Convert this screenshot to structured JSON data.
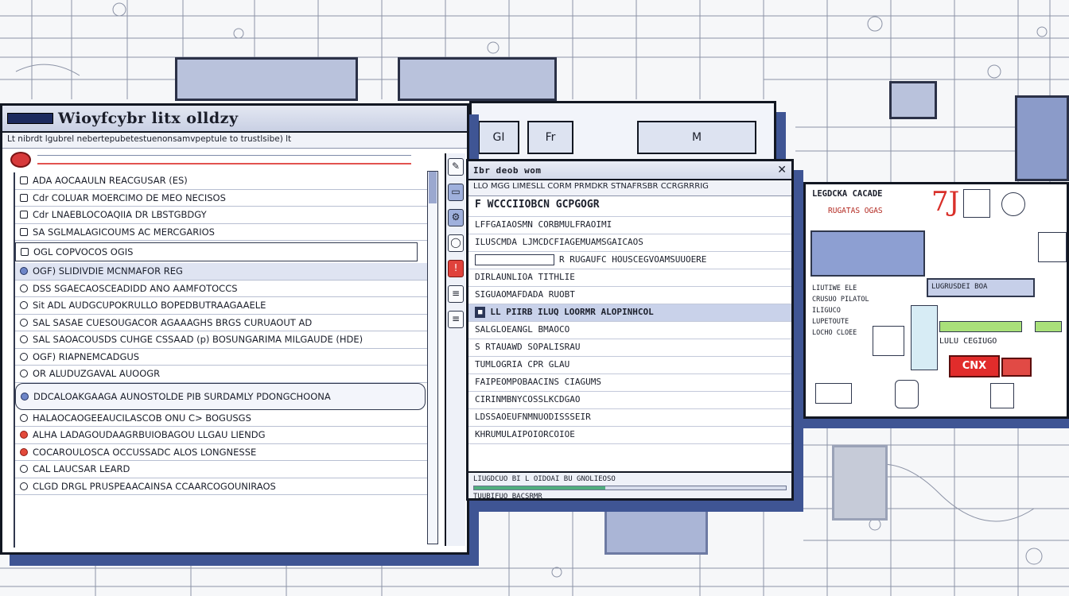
{
  "main_window": {
    "title": "Wioyfcybr litx olldzy",
    "menu": "Lt nibrdt lgubrel nebertepubetestuenonsamvpeptule to trustlsibe) lt",
    "rows": [
      "ADA AOCAAULN REACGUSAR (ES)",
      "Cdr COLUAR MOERCIMO DE MEO NECISOS",
      "Cdr LNAEBLOCOAQIIA DR LBSTGBDGY",
      "SA SGLMALAGICOUMS AC MERCGARIOS",
      "OGL COPVOCOS OGIS",
      "OGF) SLIDIVDIE MCNMAFOR REG",
      "DSS SGAECAOSCEADIDD ANO AAMFOTOCCS",
      "Sit ADL AUDGCUPOKRULLO BOPEDBUTRAAGAAELE",
      "SAL SASAE CUESOUGACOR AGAAAGHS BRGS CURUAOUT AD",
      "SAL SAOACOUSDS CUHGE CSSAAD (p) BOSUNGARIMA MILGAUDE (HDE)",
      "OGF) RIAPNEMCADGUS",
      "OR ALUDUZGAVAL AUOOGR",
      "DDCALOAKGAAGA AUNOSTOLDE PIB SURDAMLY PDONGCHOONA",
      "HALAOCAOGEEAUCILASCOB ONU C> BOGUSGS",
      "ALHA LADAGOUDAAGRBUIOBAGOU LLGAU LIENDG",
      "COCAROULOSCA OCCUSSADC ALOS LONGNESSE",
      "CAL LAUCSAR LEARD",
      "CLGD DRGL PRUSPEAACAINSA CCAARCOGOUNIRAOS"
    ]
  },
  "back_window": {
    "thumbs": [
      "GI",
      "Fr",
      "M"
    ]
  },
  "detail_window": {
    "title": "Ibr deob wom",
    "close_glyph": "✕",
    "menu": "LLO MGG LIMESLL CORM PRMDKR STNAFRSBR CCRGRRRIG",
    "rows": [
      "F WCCCIIOBCN GCPGOGR",
      "LFFGAIAOSMN CORBMULFRAOIMI",
      "ILUSCMDA LJMCDCFIAGEMUAMSGAICAOS",
      "R RUGAUFC HOUSCEGVOAMSUUOERE",
      "DIRLAUNLIOA TITHLIE",
      "SIGUAOMAFDADA RUOBT",
      "SALGLOEANGL BMAOCO",
      "S RTAUAWD SOPALISRAU",
      "TUMLOGRIA CPR GLAU",
      "FAIPEOMPOBAACINS CIAGUMS",
      "CIRINMBNYCOSSLKCDGAO",
      "LDSSAOEUFNMNUODISSSEIR",
      "KHRUMULAIPOIORCOIOE"
    ],
    "band_row": "LL PIIRB ILUQ LOORMR ALOPINHCOL",
    "status": "LIUGDCUO BI L OIDOAI BU GNOLIEOSO",
    "status2": "TUUBIFUO BACSRMR",
    "progress": 0.42
  },
  "right_window": {
    "header": "LEGDCKA CACADE",
    "sub": "RUGATAS OGAS",
    "panel_label": "LUGRUSDEI BOA",
    "list": [
      "LIUTIWE ELE",
      "CRUSUO PILATOL",
      "ILIGUCO",
      "LUPETOUTE",
      "LOCHO CLOEE"
    ],
    "alert": "CNX",
    "chip": "LULU  CEGIUGO",
    "brand_glyph": "7J"
  },
  "colors": {
    "accent_blue": "#3f5594",
    "alert_red": "#e12c2b",
    "ok_green": "#a9e07a"
  },
  "icons": {
    "doc": "record-icon",
    "tool": [
      "pencil-icon",
      "folder-icon",
      "gear-icon",
      "search-icon",
      "alert-icon",
      "list-icon"
    ]
  }
}
